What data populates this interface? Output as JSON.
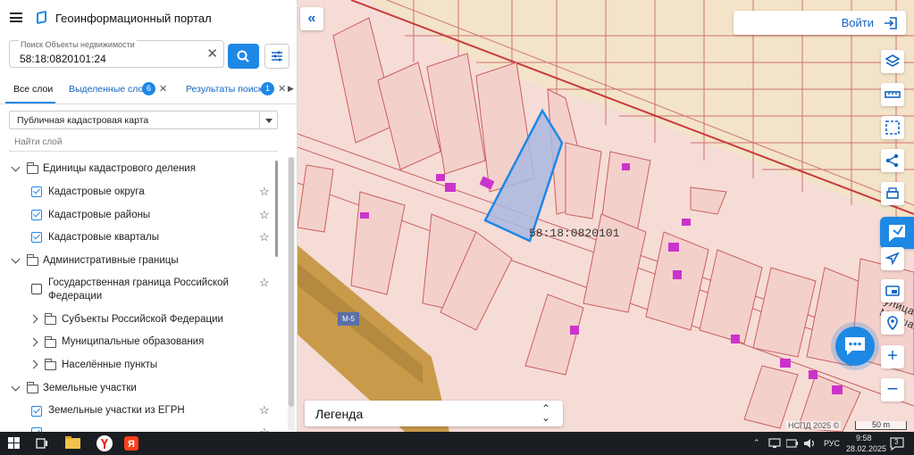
{
  "app": {
    "title": "Геоинформационный портал"
  },
  "search": {
    "label": "Поиск Объекты недвижимости",
    "value": "58:18:0820101:24"
  },
  "tabs": [
    {
      "label": "Все слои"
    },
    {
      "label": "Выделенные слои",
      "badge": "6"
    },
    {
      "label": "Результаты поиска",
      "badge": "1"
    }
  ],
  "basemap": {
    "selected": "Публичная кадастровая карта"
  },
  "layer_filter": {
    "placeholder": "Найти слой"
  },
  "tree": {
    "group1": {
      "label": "Единицы кадастрового деления",
      "items": [
        "Кадастровые округа",
        "Кадастровые районы",
        "Кадастровые кварталы"
      ]
    },
    "group2": {
      "label": "Административные границы",
      "item1_line1": "Государственная граница Российской",
      "item1_line2": "Федерации",
      "items": [
        "Субъекты Российской Федерации",
        "Муниципальные образования",
        "Населённые пункты"
      ]
    },
    "group3": {
      "label": "Земельные участки",
      "items": [
        "Земельные участки из ЕГРН"
      ]
    }
  },
  "map": {
    "quarter_label": "58:18:0820101",
    "street_label": "улица Мокшанцева",
    "road_sign": "М-5",
    "legend_label": "Легенда",
    "copyright": "НСПД 2025 ©",
    "scale": "50 m",
    "login_label": "Войти",
    "parcel_fill": "#a9b9e0",
    "parcel_stroke": "#1e88e5",
    "boundary_color": "#d07070",
    "building_color": "#cc33cc"
  },
  "taskbar": {
    "time": "9:58",
    "date": "28.02.2025",
    "lang": "РУС",
    "notifications": "3"
  }
}
